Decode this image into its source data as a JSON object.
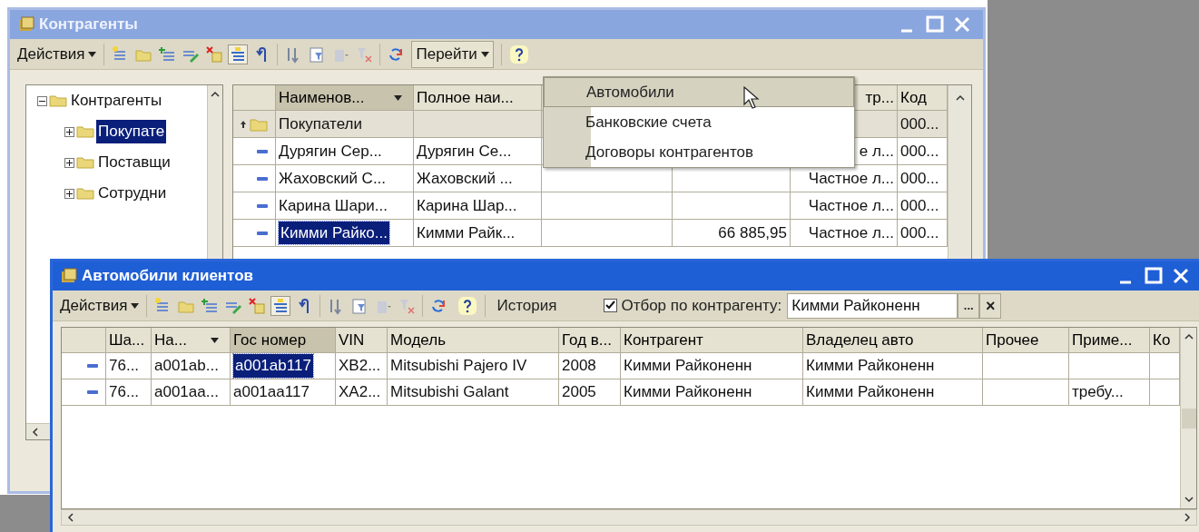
{
  "main_window": {
    "title": "Контрагенты",
    "active": false,
    "toolbar": {
      "actions_menu": "Действия",
      "goto_menu": "Перейти"
    },
    "tree": [
      {
        "label": "Контрагенты",
        "expanded": true,
        "selected": false,
        "children": [
          {
            "label": "Покупате",
            "expanded": false,
            "selected": true
          },
          {
            "label": "Поставщи",
            "expanded": false,
            "selected": false
          },
          {
            "label": "Сотрудни",
            "expanded": false,
            "selected": false
          }
        ]
      }
    ],
    "table": {
      "columns": [
        {
          "label": "Наименов...",
          "sorted": true,
          "current": true
        },
        {
          "label": "Полное наи...",
          "sorted": false,
          "current": false
        },
        {},
        {},
        {
          "label": "тр...",
          "sorted": false,
          "current": false
        },
        {
          "label": "Код",
          "sorted": false,
          "current": false
        }
      ],
      "rows": [
        {
          "kind": "group",
          "selected": false,
          "cells": [
            {
              "text": "Покупатели"
            },
            {},
            {},
            {},
            {},
            {
              "text": "000..."
            }
          ]
        },
        {
          "kind": "item",
          "selected": false,
          "cells": [
            {
              "text": "Дурягин Сер..."
            },
            {
              "text": "Дурягин Се..."
            },
            {},
            {},
            {
              "text": "е л..."
            },
            {
              "text": "000..."
            }
          ]
        },
        {
          "kind": "item",
          "selected": false,
          "cells": [
            {
              "text": "Жаховский С..."
            },
            {
              "text": "Жаховский ..."
            },
            {},
            {},
            {
              "text": "Частное л..."
            },
            {
              "text": "000..."
            }
          ]
        },
        {
          "kind": "item",
          "selected": false,
          "cells": [
            {
              "text": "Карина Шари..."
            },
            {
              "text": "Карина Шар..."
            },
            {},
            {},
            {
              "text": "Частное л..."
            },
            {
              "text": "000..."
            }
          ]
        },
        {
          "kind": "item",
          "selected": true,
          "cells": [
            {
              "text": "Кимми Райко..."
            },
            {
              "text": "Кимми Райк..."
            },
            {},
            {
              "text": "66 885,95"
            },
            {
              "text": "Частное л..."
            },
            {
              "text": "000..."
            }
          ]
        }
      ]
    }
  },
  "goto_menu": {
    "items": [
      {
        "label": "Автомобили",
        "highlighted": true
      },
      {
        "label": "Банковские счета",
        "highlighted": false
      },
      {
        "label": "Договоры контрагентов",
        "highlighted": false
      }
    ]
  },
  "cars_window": {
    "title": "Автомобили клиентов",
    "active": true,
    "toolbar": {
      "actions_menu": "Действия",
      "history_button": "История",
      "filter": {
        "checked": true,
        "label": "Отбор по контрагенту:",
        "value": "Кимми Райконенн",
        "select_button": "...",
        "clear_button": "×"
      }
    },
    "table": {
      "columns": [
        {
          "label": "Ша...",
          "sorted": false,
          "current": false
        },
        {
          "label": "На...",
          "sorted": true,
          "current": false
        },
        {
          "label": "Гос номер",
          "sorted": false,
          "current": true
        },
        {
          "label": "VIN",
          "sorted": false,
          "current": false
        },
        {
          "label": "Модель",
          "sorted": false,
          "current": false
        },
        {
          "label": "Год в...",
          "sorted": false,
          "current": false
        },
        {
          "label": "Контрагент",
          "sorted": false,
          "current": false
        },
        {
          "label": "Владелец авто",
          "sorted": false,
          "current": false
        },
        {
          "label": "Прочее",
          "sorted": false,
          "current": false
        },
        {
          "label": "Приме...",
          "sorted": false,
          "current": false
        },
        {
          "label": "Ко",
          "sorted": false,
          "current": false
        }
      ],
      "rows": [
        {
          "kind": "item",
          "selected": true,
          "cells": [
            {
              "text": "76..."
            },
            {
              "text": "a001ab..."
            },
            {
              "text": "a001ab117"
            },
            {
              "text": "XB2..."
            },
            {
              "text": "Mitsubishi Pajero IV"
            },
            {
              "text": "2008"
            },
            {
              "text": "Кимми Райконенн"
            },
            {
              "text": "Кимми Райконенн"
            },
            {},
            {},
            {}
          ]
        },
        {
          "kind": "item",
          "selected": false,
          "cells": [
            {
              "text": "76..."
            },
            {
              "text": "a001aa..."
            },
            {
              "text": "a001aa117"
            },
            {
              "text": "XA2..."
            },
            {
              "text": "Mitsubishi Galant"
            },
            {
              "text": "2005"
            },
            {
              "text": "Кимми Райконенн"
            },
            {
              "text": "Кимми Райконенн"
            },
            {},
            {
              "text": "требу..."
            },
            {}
          ]
        }
      ]
    }
  }
}
